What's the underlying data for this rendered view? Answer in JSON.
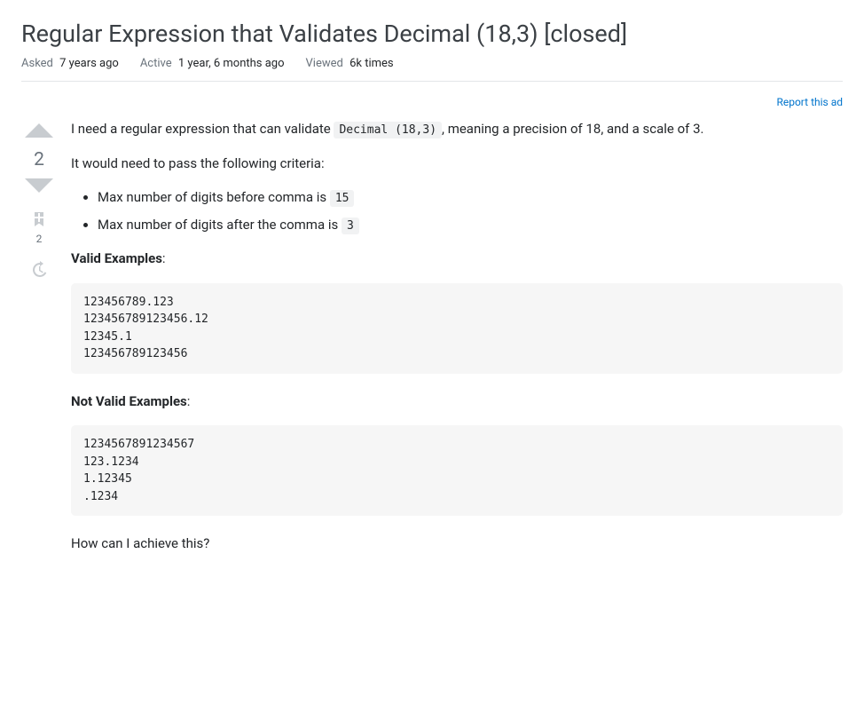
{
  "title": "Regular Expression that Validates Decimal (18,3) [closed]",
  "meta": {
    "asked_label": "Asked",
    "asked_value": "7 years ago",
    "active_label": "Active",
    "active_value": "1 year, 6 months ago",
    "viewed_label": "Viewed",
    "viewed_value": "6k times"
  },
  "report_ad": "Report this ad",
  "vote": {
    "score": "2",
    "bookmark_count": "2"
  },
  "body": {
    "p1_prefix": "I need a regular expression that can validate ",
    "p1_code": "Decimal (18,3)",
    "p1_suffix": ", meaning a precision of 18, and a scale of 3.",
    "p2": "It would need to pass the following criteria:",
    "li1_prefix": "Max number of digits before comma is ",
    "li1_code": "15",
    "li2_prefix": "Max number of digits after the comma is ",
    "li2_code": "3",
    "valid_heading": "Valid Examples",
    "valid_colon": ":",
    "valid_code": "123456789.123\n123456789123456.12\n12345.1\n123456789123456",
    "invalid_heading": "Not Valid Examples",
    "invalid_colon": ":",
    "invalid_code": "1234567891234567\n123.1234\n1.12345\n.1234",
    "p3": "How can I achieve this?"
  }
}
